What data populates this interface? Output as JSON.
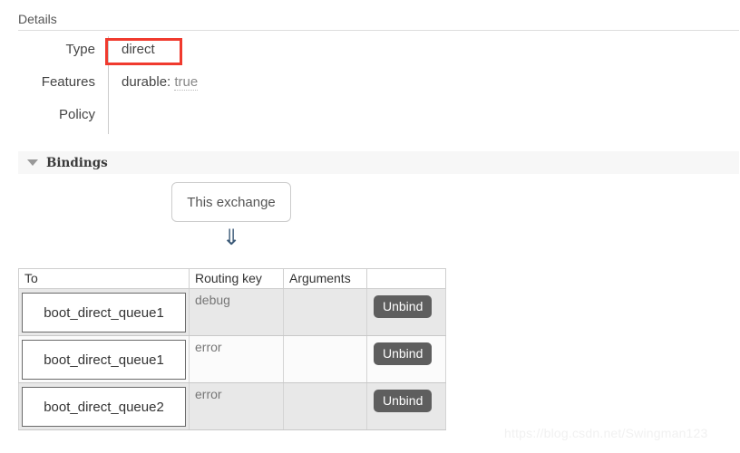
{
  "details": {
    "heading": "Details",
    "rows": [
      {
        "label": "Type",
        "value": "direct",
        "dim_value": "",
        "highlighted": true
      },
      {
        "label": "Features",
        "value": "durable:",
        "dim_value": "true",
        "highlighted": false
      },
      {
        "label": "Policy",
        "value": "",
        "dim_value": "",
        "highlighted": false
      }
    ]
  },
  "bindings": {
    "section_title": "Bindings",
    "caret_icon": "triangle-down-icon",
    "source_box_label": "This exchange",
    "arrow_icon": "double-down-arrow-icon",
    "arrow_glyph": "⇓",
    "table": {
      "columns": [
        "To",
        "Routing key",
        "Arguments",
        ""
      ],
      "rows": [
        {
          "to": "boot_direct_queue1",
          "routing_key": "debug",
          "arguments": "",
          "action": "Unbind"
        },
        {
          "to": "boot_direct_queue1",
          "routing_key": "error",
          "arguments": "",
          "action": "Unbind"
        },
        {
          "to": "boot_direct_queue2",
          "routing_key": "error",
          "arguments": "",
          "action": "Unbind"
        }
      ]
    }
  },
  "watermark": "https://blog.csdn.net/Swingman123",
  "colors": {
    "annotation_red": "#f03a2e",
    "button_grey": "#5e5e5e",
    "section_bar": "#f7f7f7",
    "row_odd": "#e8e8e8",
    "row_even": "#fbfbfb"
  }
}
